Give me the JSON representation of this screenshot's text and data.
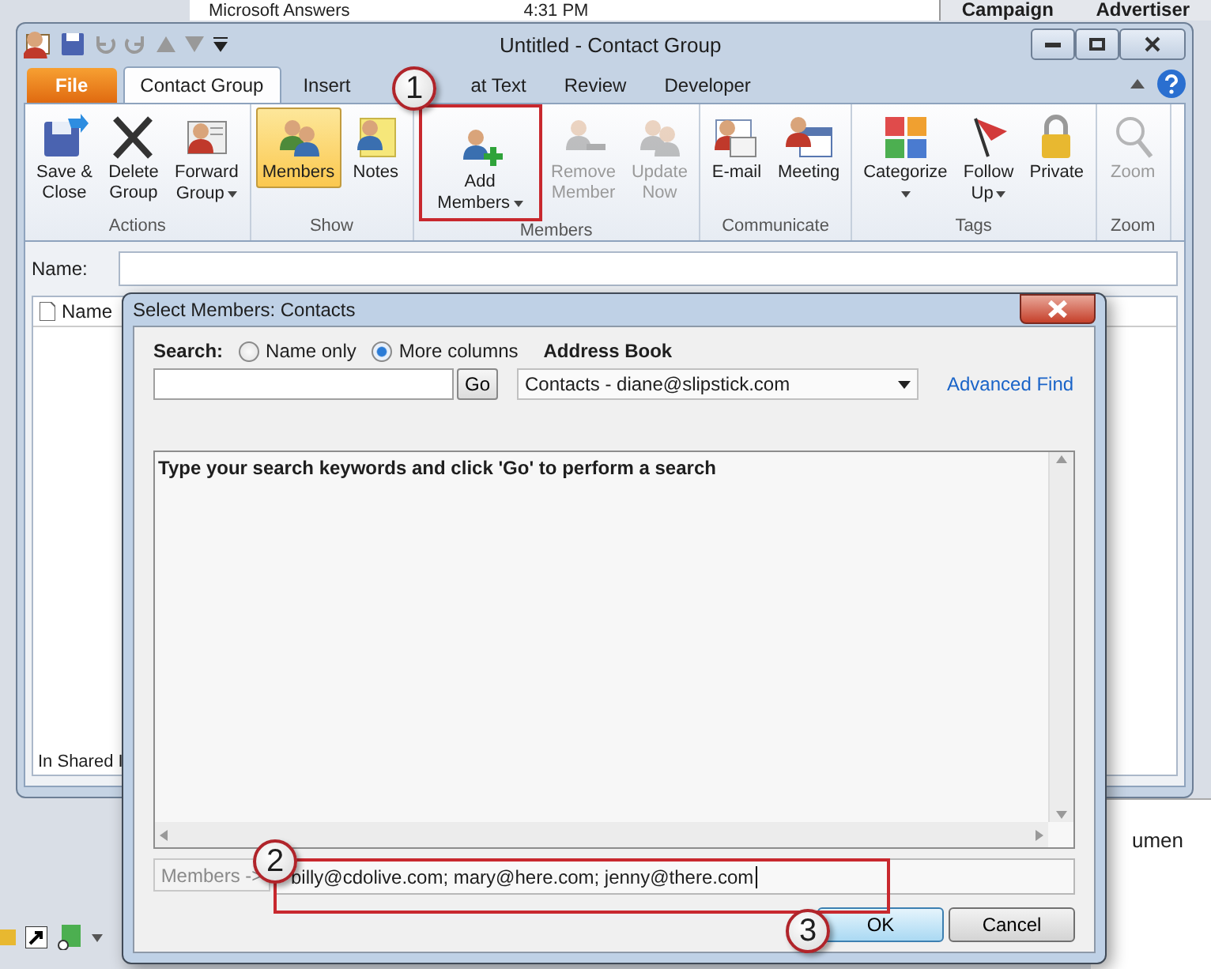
{
  "background": {
    "list_items": [
      {
        "subject": "Microsoft Answers",
        "time": "4:31 PM"
      }
    ],
    "columns": [
      "Campaign",
      "Advertiser"
    ],
    "fragment": "umen"
  },
  "window": {
    "title": "Untitled  -  Contact Group",
    "tabs": [
      {
        "label": "File",
        "kind": "file",
        "selected": false
      },
      {
        "label": "Contact Group",
        "kind": "tab",
        "selected": true
      },
      {
        "label": "Insert",
        "kind": "tab",
        "selected": false
      },
      {
        "label": "at Text",
        "kind": "tab",
        "selected": false
      },
      {
        "label": "Review",
        "kind": "tab",
        "selected": false
      },
      {
        "label": "Developer",
        "kind": "tab",
        "selected": false
      }
    ],
    "ribbon": [
      {
        "label": "Actions",
        "buttons": [
          {
            "label": "Save &\nClose",
            "dropdown": false,
            "disabled": false,
            "selected": false
          },
          {
            "label": "Delete\nGroup",
            "dropdown": false,
            "disabled": false,
            "selected": false
          },
          {
            "label": "Forward\nGroup",
            "dropdown": true,
            "disabled": false,
            "selected": false
          }
        ]
      },
      {
        "label": "Show",
        "buttons": [
          {
            "label": "Members",
            "dropdown": false,
            "disabled": false,
            "selected": true
          },
          {
            "label": "Notes",
            "dropdown": false,
            "disabled": false,
            "selected": false
          }
        ]
      },
      {
        "label": "Members",
        "buttons": [
          {
            "label": "Add\nMembers",
            "dropdown": true,
            "disabled": false,
            "selected": false,
            "highlighted": true
          },
          {
            "label": "Remove\nMember",
            "dropdown": false,
            "disabled": true,
            "selected": false
          },
          {
            "label": "Update\nNow",
            "dropdown": false,
            "disabled": true,
            "selected": false
          }
        ]
      },
      {
        "label": "Communicate",
        "buttons": [
          {
            "label": "E-mail",
            "dropdown": false,
            "disabled": false,
            "selected": false
          },
          {
            "label": "Meeting",
            "dropdown": false,
            "disabled": false,
            "selected": false
          }
        ]
      },
      {
        "label": "Tags",
        "buttons": [
          {
            "label": "Categorize",
            "dropdown": true,
            "disabled": false,
            "selected": false
          },
          {
            "label": "Follow\nUp",
            "dropdown": true,
            "disabled": false,
            "selected": false
          },
          {
            "label": "Private",
            "dropdown": false,
            "disabled": false,
            "selected": false
          }
        ]
      },
      {
        "label": "Zoom",
        "buttons": [
          {
            "label": "Zoom",
            "dropdown": false,
            "disabled": true,
            "selected": false
          }
        ]
      }
    ],
    "name_label": "Name:",
    "list": {
      "column": "Name",
      "footer": "In Shared I"
    }
  },
  "dialog": {
    "title": "Select Members: Contacts",
    "search_label": "Search:",
    "search_options": [
      {
        "label": "Name only",
        "selected": false
      },
      {
        "label": "More columns",
        "selected": true
      }
    ],
    "address_book_label": "Address Book",
    "go_button": "Go",
    "address_book": "Contacts - diane@slipstick.com",
    "advanced_find": "Advanced Find",
    "results_message": "Type your search keywords and click 'Go' to perform a search",
    "members_button": "Members ->",
    "members_value": "billy@cdolive.com; mary@here.com; jenny@there.com",
    "buttons": [
      {
        "label": "OK",
        "focused": true
      },
      {
        "label": "Cancel",
        "focused": false
      }
    ]
  },
  "callouts": [
    "1",
    "2",
    "3"
  ]
}
